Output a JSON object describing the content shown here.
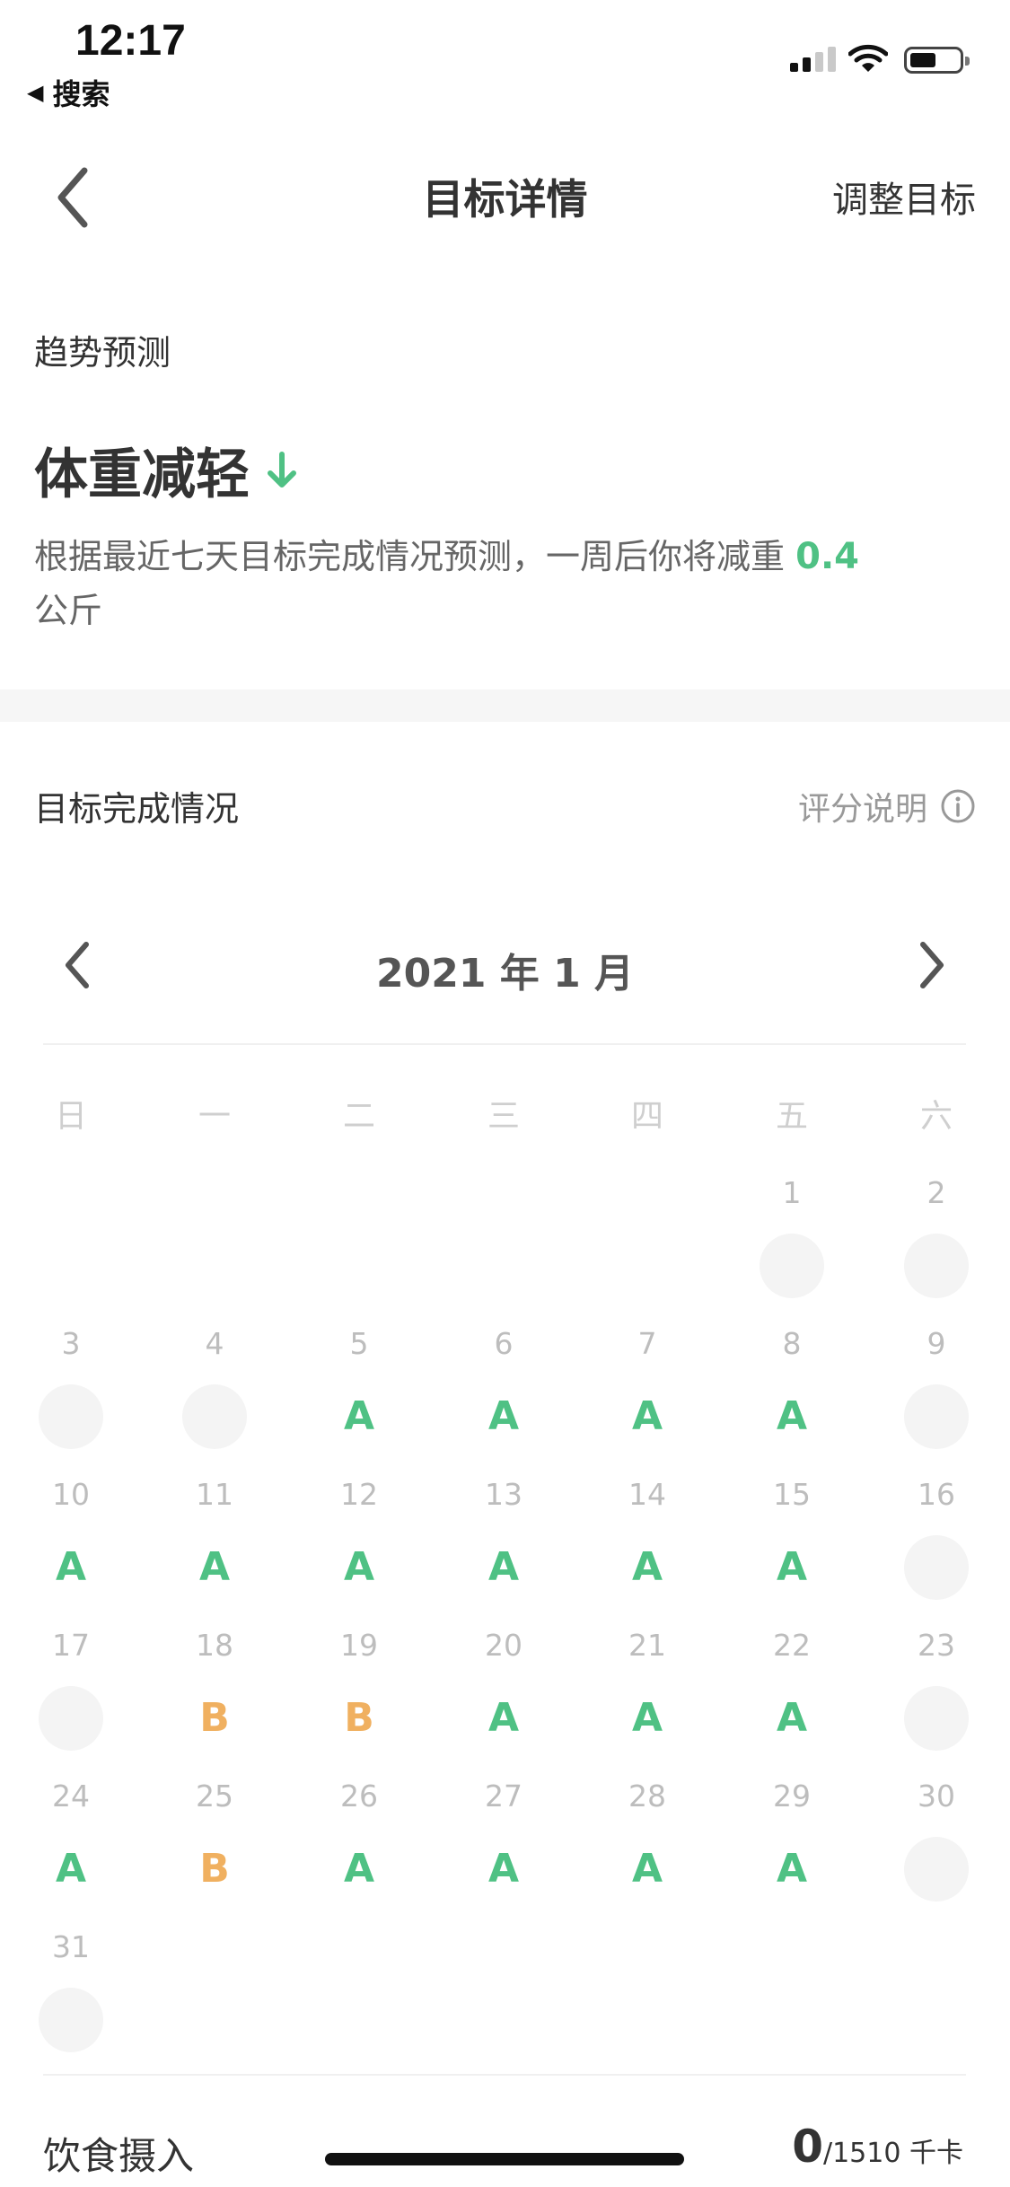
{
  "status_bar": {
    "time": "12:17",
    "back_to_app": "搜索"
  },
  "nav": {
    "title": "目标详情",
    "adjust_label": "调整目标"
  },
  "trend": {
    "section_label": "趋势预测",
    "title": "体重减轻",
    "desc_before": "根据最近七天目标完成情况预测，一周后你将减重",
    "desc_value": "0.4",
    "desc_after": "公斤"
  },
  "completion": {
    "section_label": "目标完成情况",
    "rating_help_label": "评分说明",
    "month_label": "2021 年 1 月",
    "weekdays": [
      "日",
      "一",
      "二",
      "三",
      "四",
      "五",
      "六"
    ],
    "days": [
      {
        "day": "1",
        "grade": ""
      },
      {
        "day": "2",
        "grade": ""
      },
      {
        "day": "3",
        "grade": ""
      },
      {
        "day": "4",
        "grade": ""
      },
      {
        "day": "5",
        "grade": "A"
      },
      {
        "day": "6",
        "grade": "A"
      },
      {
        "day": "7",
        "grade": "A"
      },
      {
        "day": "8",
        "grade": "A"
      },
      {
        "day": "9",
        "grade": ""
      },
      {
        "day": "10",
        "grade": "A"
      },
      {
        "day": "11",
        "grade": "A"
      },
      {
        "day": "12",
        "grade": "A"
      },
      {
        "day": "13",
        "grade": "A"
      },
      {
        "day": "14",
        "grade": "A"
      },
      {
        "day": "15",
        "grade": "A"
      },
      {
        "day": "16",
        "grade": ""
      },
      {
        "day": "17",
        "grade": ""
      },
      {
        "day": "18",
        "grade": "B"
      },
      {
        "day": "19",
        "grade": "B"
      },
      {
        "day": "20",
        "grade": "A"
      },
      {
        "day": "21",
        "grade": "A"
      },
      {
        "day": "22",
        "grade": "A"
      },
      {
        "day": "23",
        "grade": ""
      },
      {
        "day": "24",
        "grade": "A"
      },
      {
        "day": "25",
        "grade": "B"
      },
      {
        "day": "26",
        "grade": "A"
      },
      {
        "day": "27",
        "grade": "A"
      },
      {
        "day": "28",
        "grade": "A"
      },
      {
        "day": "29",
        "grade": "A"
      },
      {
        "day": "30",
        "grade": ""
      },
      {
        "day": "31",
        "grade": ""
      }
    ],
    "first_weekday_index": 5
  },
  "intake": {
    "label": "饮食摄入",
    "current": "0",
    "target": "/1510",
    "unit": "千卡"
  },
  "colors": {
    "grade_a": "#4fc184",
    "grade_b": "#f0b060",
    "trend_down": "#4fc184"
  }
}
